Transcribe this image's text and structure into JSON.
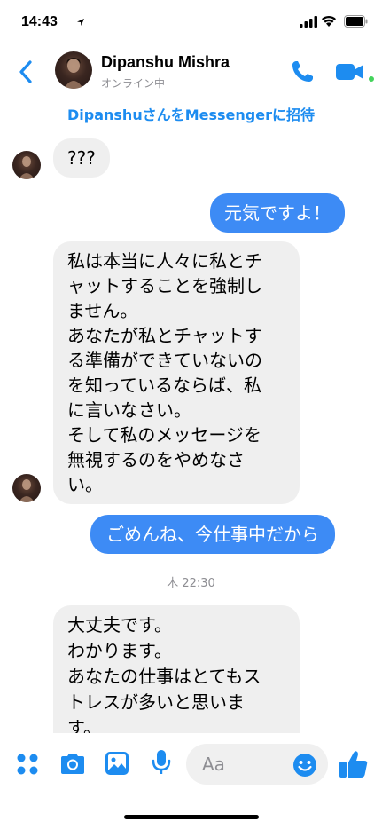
{
  "status": {
    "time": "14:43"
  },
  "header": {
    "name": "Dipanshu Mishra",
    "presence": "オンライン中"
  },
  "invite_link": "DipanshuさんをMessengerに招待",
  "messages": [
    {
      "from": "them",
      "text": "???"
    },
    {
      "from": "me",
      "text": "元気ですよ！"
    },
    {
      "from": "them",
      "text": "私は本当に人々に私とチ\nャットすることを強制し\nません。\nあなたが私とチャットす\nる準備ができていないの\nを知っているならば、私\nに言いなさい。\nそして私のメッセージを\n無視するのをやめなさ\nい。"
    },
    {
      "from": "me",
      "text": "ごめんね、今仕事中だから"
    },
    {
      "from": "them",
      "text": "大丈夫です。\nわかります。\nあなたの仕事はとてもス\nトレスが多いと思いま\nす。"
    }
  ],
  "timestamp": "木 22:30",
  "composer": {
    "placeholder": "Aa"
  },
  "colors": {
    "accent": "#1d8cf0",
    "outgoing_bubble": "#3d8bf5",
    "incoming_bubble": "#efefef",
    "online_dot": "#44d35c"
  },
  "icons": [
    "back-arrow-icon",
    "phone-icon",
    "video-camera-icon",
    "menu-dots-icon",
    "camera-icon",
    "photo-icon",
    "microphone-icon",
    "emoji-icon",
    "thumbs-up-icon"
  ]
}
